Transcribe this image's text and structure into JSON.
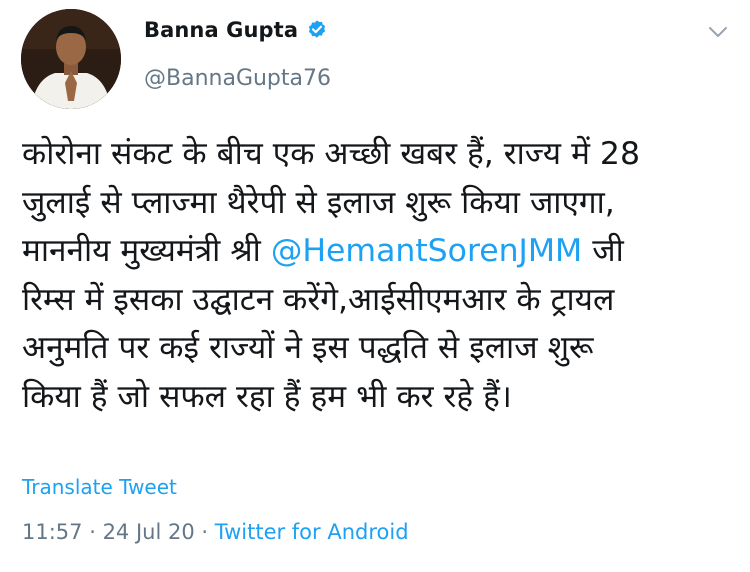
{
  "tweet": {
    "author": {
      "name": "Banna Gupta",
      "handle": "@BannaGupta76",
      "verified": true
    },
    "body_lines": [
      {
        "before": "कोरोना संकट के बीच एक अच्छी खबर हैं, राज्य में 28",
        "mention": "",
        "after": ""
      },
      {
        "before": "जुलाई से प्लाज्मा थैरेपी से इलाज शुरू किया जाएगा,",
        "mention": "",
        "after": ""
      },
      {
        "before": "माननीय मुख्यमंत्री श्री ",
        "mention": "@HemantSorenJMM",
        "after": " जी"
      },
      {
        "before": "रिम्स में इसका उद्घाटन करेंगे,आईसीएमआर के ट्रायल",
        "mention": "",
        "after": ""
      },
      {
        "before": "अनुमति पर कई राज्यों ने इस पद्धति से इलाज शुरू",
        "mention": "",
        "after": ""
      },
      {
        "before": "किया हैं जो सफल रहा हैं हम भी कर रहे हैं।",
        "mention": "",
        "after": ""
      }
    ],
    "translate_label": "Translate Tweet",
    "time": "11:57",
    "date": "24 Jul 20",
    "separator": " · ",
    "source": "Twitter for Android"
  },
  "colors": {
    "link": "#1da1f2",
    "secondary_text": "#657786",
    "primary_text": "#14171a"
  },
  "icons": {
    "verified": "verified-badge-icon",
    "menu": "chevron-down-icon"
  }
}
